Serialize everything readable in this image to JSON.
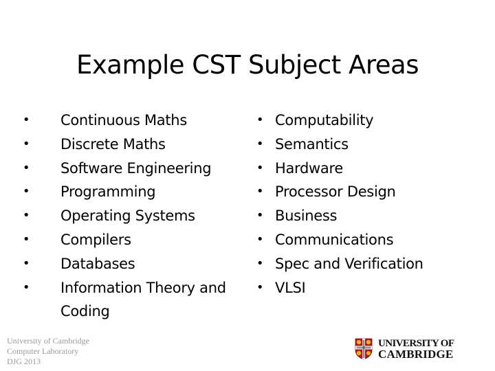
{
  "slide": {
    "title": "Example CST Subject Areas",
    "left_column": [
      "Continuous Maths",
      "Discrete Maths",
      "Software Engineering",
      "Programming",
      "Operating Systems",
      "Compilers",
      "Databases",
      "Information Theory and Coding"
    ],
    "right_column": [
      "Computability",
      "Semantics",
      "Hardware",
      "Processor Design",
      "Business",
      "Communications",
      "Spec and Verification",
      "VLSI"
    ],
    "bullet_glyph": "•"
  },
  "footer": {
    "lines": [
      "University of Cambridge",
      "Computer Laboratory",
      "DJG 2013"
    ]
  },
  "logo": {
    "icon": "university-crest-icon",
    "line1": "UNIVERSITY OF",
    "line2": "CAMBRIDGE",
    "colors": {
      "crest_red": "#b5161b",
      "crest_gold": "#e8b51e",
      "crest_white": "#ffffff"
    }
  }
}
